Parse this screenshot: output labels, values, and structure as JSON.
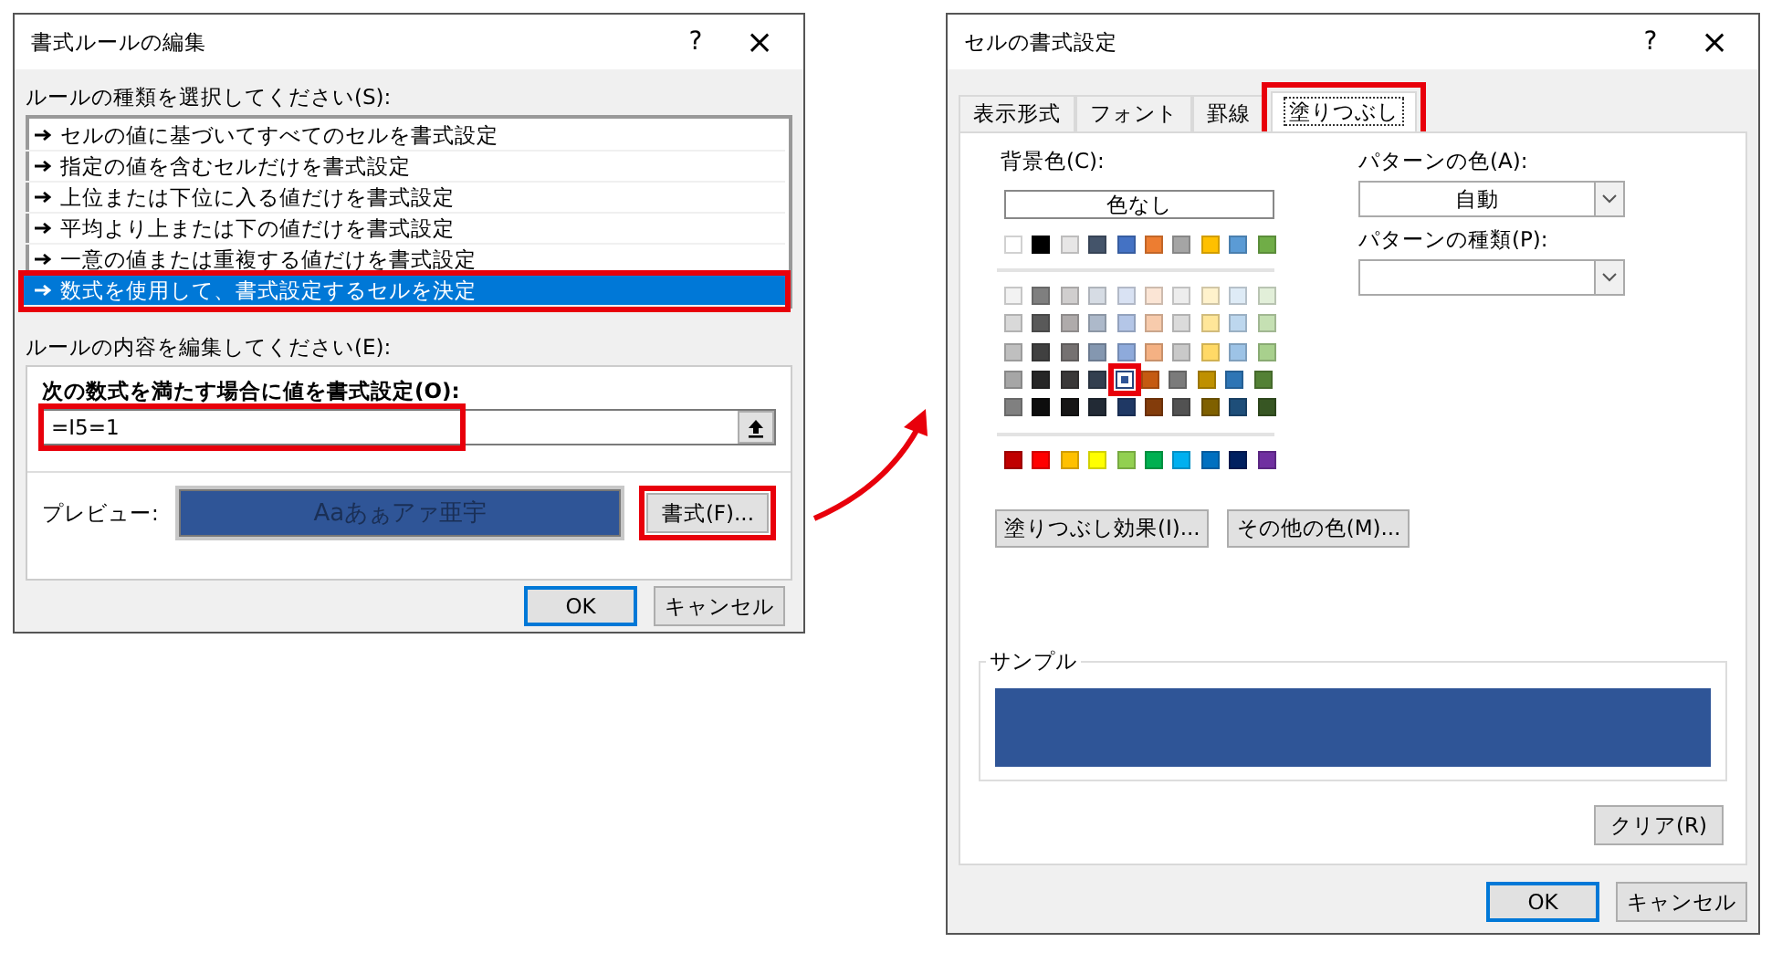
{
  "rule_dialog": {
    "title": "書式ルールの編集",
    "help": "?",
    "close": "×",
    "rule_type_label": "ルールの種類を選択してください(S):",
    "rule_types": [
      {
        "label": "セルの値に基づいてすべてのセルを書式設定",
        "selected": false,
        "highlighted": false
      },
      {
        "label": "指定の値を含むセルだけを書式設定",
        "selected": false,
        "highlighted": false
      },
      {
        "label": "上位または下位に入る値だけを書式設定",
        "selected": false,
        "highlighted": false
      },
      {
        "label": "平均より上または下の値だけを書式設定",
        "selected": false,
        "highlighted": false
      },
      {
        "label": "一意の値または重複する値だけを書式設定",
        "selected": false,
        "highlighted": false
      },
      {
        "label": "数式を使用して、書式設定するセルを決定",
        "selected": true,
        "highlighted": true
      }
    ],
    "edit_label": "ルールの内容を編集してください(E):",
    "formula_label": "次の数式を満たす場合に値を書式設定(O):",
    "formula": {
      "value": "=I5=1",
      "highlighted": true
    },
    "preview_label": "プレビュー:",
    "preview": {
      "text": "Aaあぁアァ亜宇",
      "color": "#2f5597"
    },
    "format_button": {
      "label": "書式(F)...",
      "highlighted": true
    },
    "buttons": [
      "OK",
      "キャンセル"
    ]
  },
  "format_dialog": {
    "title": "セルの書式設定",
    "help": "?",
    "close": "×",
    "tabs": [
      {
        "label": "表示形式",
        "selected": false,
        "highlighted": false
      },
      {
        "label": "フォント",
        "selected": false,
        "highlighted": false
      },
      {
        "label": "罫線",
        "selected": false,
        "highlighted": false
      },
      {
        "label": "塗りつぶし",
        "selected": true,
        "highlighted": true
      }
    ],
    "background_label": "背景色(C):",
    "no_color_button": "色なし",
    "theme_row": [
      {
        "color": "#ffffff",
        "selected": false
      },
      {
        "color": "#000000",
        "selected": false
      },
      {
        "color": "#e7e6e6",
        "selected": false
      },
      {
        "color": "#44546a",
        "selected": false
      },
      {
        "color": "#4472c4",
        "selected": false
      },
      {
        "color": "#ed7d31",
        "selected": false
      },
      {
        "color": "#a5a5a5",
        "selected": false
      },
      {
        "color": "#ffc000",
        "selected": false
      },
      {
        "color": "#5b9bd5",
        "selected": false
      },
      {
        "color": "#70ad47",
        "selected": false
      }
    ],
    "shade_rows": [
      [
        {
          "color": "#f2f2f2",
          "selected": false
        },
        {
          "color": "#7f7f7f",
          "selected": false
        },
        {
          "color": "#d0cece",
          "selected": false
        },
        {
          "color": "#d6dce4",
          "selected": false
        },
        {
          "color": "#d9e2f3",
          "selected": false
        },
        {
          "color": "#fbe5d5",
          "selected": false
        },
        {
          "color": "#ededed",
          "selected": false
        },
        {
          "color": "#fff2cc",
          "selected": false
        },
        {
          "color": "#deebf6",
          "selected": false
        },
        {
          "color": "#e2efd9",
          "selected": false
        }
      ],
      [
        {
          "color": "#d9d9d9",
          "selected": false
        },
        {
          "color": "#595959",
          "selected": false
        },
        {
          "color": "#afabab",
          "selected": false
        },
        {
          "color": "#adb9ca",
          "selected": false
        },
        {
          "color": "#b4c6e7",
          "selected": false
        },
        {
          "color": "#f7cbac",
          "selected": false
        },
        {
          "color": "#dbdbdb",
          "selected": false
        },
        {
          "color": "#ffe699",
          "selected": false
        },
        {
          "color": "#bdd7ee",
          "selected": false
        },
        {
          "color": "#c5e0b3",
          "selected": false
        }
      ],
      [
        {
          "color": "#bfbfbf",
          "selected": false
        },
        {
          "color": "#404040",
          "selected": false
        },
        {
          "color": "#757171",
          "selected": false
        },
        {
          "color": "#8497b0",
          "selected": false
        },
        {
          "color": "#8eaadb",
          "selected": false
        },
        {
          "color": "#f4b183",
          "selected": false
        },
        {
          "color": "#c9c9c9",
          "selected": false
        },
        {
          "color": "#ffd966",
          "selected": false
        },
        {
          "color": "#9dc3e6",
          "selected": false
        },
        {
          "color": "#a8d08d",
          "selected": false
        }
      ],
      [
        {
          "color": "#a6a6a6",
          "selected": false
        },
        {
          "color": "#262626",
          "selected": false
        },
        {
          "color": "#3a3838",
          "selected": false
        },
        {
          "color": "#333f4f",
          "selected": false
        },
        {
          "color": "#2f5496",
          "selected": true
        },
        {
          "color": "#c55a11",
          "selected": false
        },
        {
          "color": "#7b7b7b",
          "selected": false
        },
        {
          "color": "#bf9000",
          "selected": false
        },
        {
          "color": "#2e75b5",
          "selected": false
        },
        {
          "color": "#538135",
          "selected": false
        }
      ],
      [
        {
          "color": "#808080",
          "selected": false
        },
        {
          "color": "#0d0d0d",
          "selected": false
        },
        {
          "color": "#171616",
          "selected": false
        },
        {
          "color": "#222a35",
          "selected": false
        },
        {
          "color": "#1f3864",
          "selected": false
        },
        {
          "color": "#833c0b",
          "selected": false
        },
        {
          "color": "#525252",
          "selected": false
        },
        {
          "color": "#7f6000",
          "selected": false
        },
        {
          "color": "#1e4e79",
          "selected": false
        },
        {
          "color": "#375623",
          "selected": false
        }
      ]
    ],
    "standard_row": [
      {
        "color": "#c00000",
        "selected": false
      },
      {
        "color": "#ff0000",
        "selected": false
      },
      {
        "color": "#ffc000",
        "selected": false
      },
      {
        "color": "#ffff00",
        "selected": false
      },
      {
        "color": "#92d050",
        "selected": false
      },
      {
        "color": "#00b050",
        "selected": false
      },
      {
        "color": "#00b0f0",
        "selected": false
      },
      {
        "color": "#0070c0",
        "selected": false
      },
      {
        "color": "#002060",
        "selected": false
      },
      {
        "color": "#7030a0",
        "selected": false
      }
    ],
    "fill_effects_button": "塗りつぶし効果(I)...",
    "more_colors_button": "その他の色(M)...",
    "pattern_color_label": "パターンの色(A):",
    "pattern_color": "自動",
    "pattern_style_label": "パターンの種類(P):",
    "sample_label": "サンプル",
    "sample": {
      "color": "#2f5597"
    },
    "clear_button": "クリア(R)",
    "buttons": [
      "OK",
      "キャンセル"
    ]
  }
}
